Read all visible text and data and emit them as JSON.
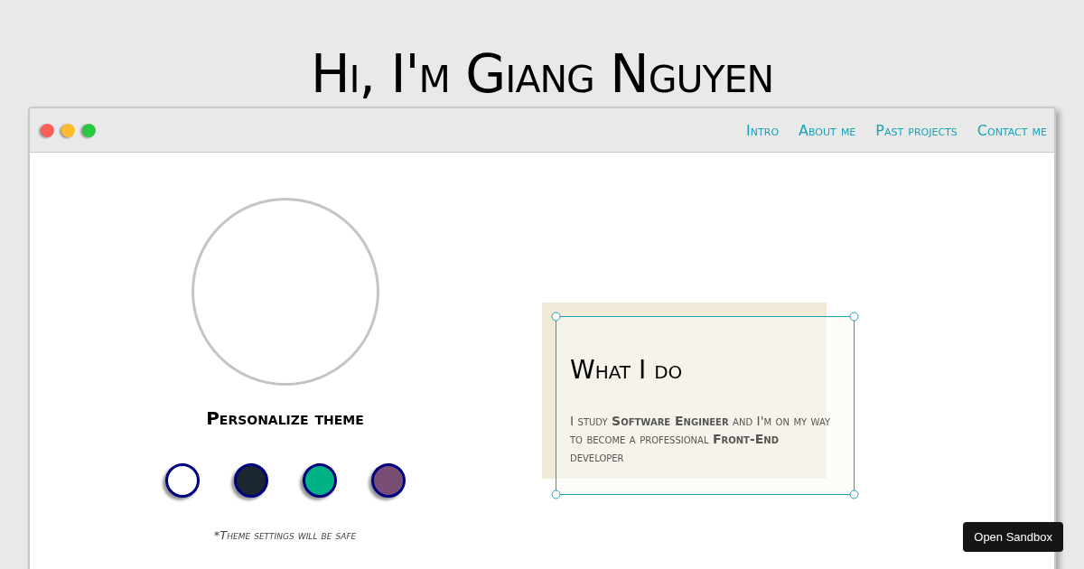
{
  "heading": "Hi, I'm Giang Nguyen",
  "window": {
    "nav": [
      {
        "label": "Intro"
      },
      {
        "label": "About me"
      },
      {
        "label": "Past projects"
      },
      {
        "label": "Contact me"
      }
    ]
  },
  "theme": {
    "title": "Personalize theme",
    "swatches": [
      {
        "color": "#ffffff"
      },
      {
        "color": "#1b2631"
      },
      {
        "color": "#00b386"
      },
      {
        "color": "#7a4e74"
      }
    ],
    "note": "*Theme settings will be safe"
  },
  "card": {
    "title": "What I do",
    "text": "I study **Software Engineer** and I'm on my way to become a professional **Front-End** developer"
  },
  "sandbox_button": "Open Sandbox"
}
